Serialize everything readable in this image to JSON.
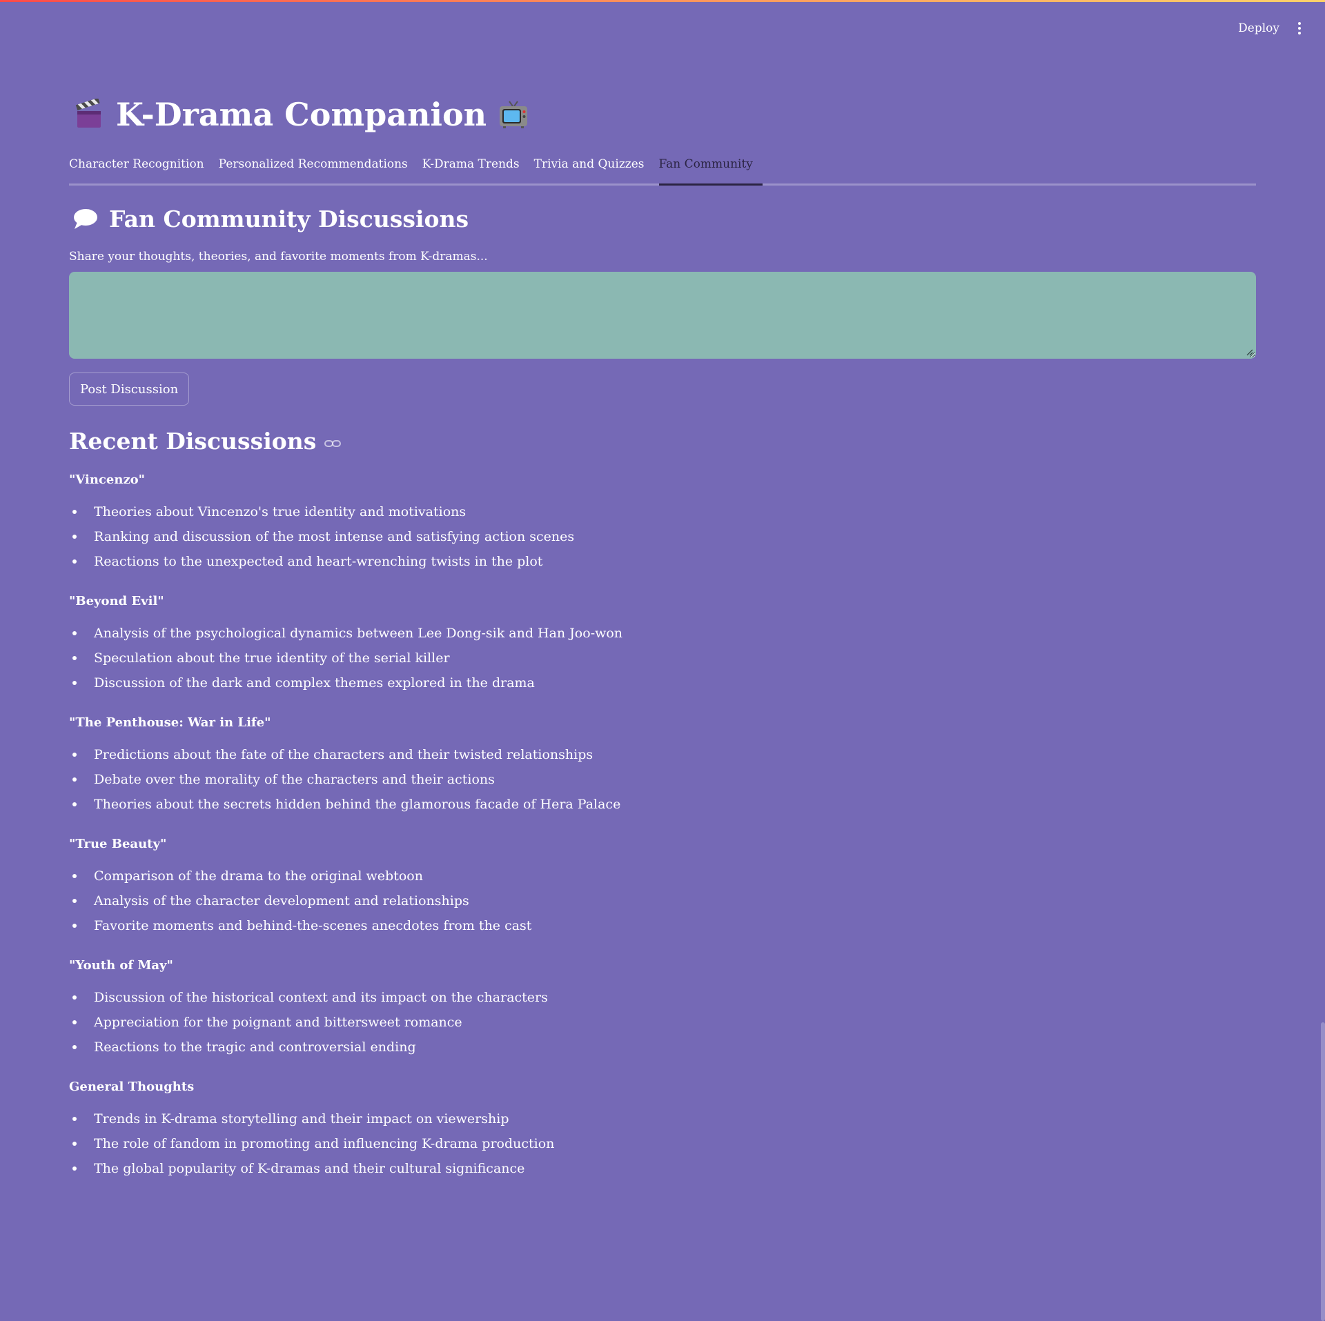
{
  "header": {
    "deploy_label": "Deploy",
    "menu_icon": "more-vertical-icon"
  },
  "app": {
    "title": "K-Drama Companion",
    "title_icon_left": "clapper-board-icon",
    "title_icon_right": "television-icon"
  },
  "tabs": [
    {
      "label": "Character Recognition",
      "active": false
    },
    {
      "label": "Personalized Recommendations",
      "active": false
    },
    {
      "label": "K-Drama Trends",
      "active": false
    },
    {
      "label": "Trivia and Quizzes",
      "active": false
    },
    {
      "label": "Fan Community",
      "active": true
    }
  ],
  "fan_community": {
    "heading": "Fan Community Discussions",
    "heading_icon": "speech-balloon-icon",
    "input_label": "Share your thoughts, theories, and favorite moments from K-dramas...",
    "input_value": "",
    "post_button_label": "Post Discussion"
  },
  "recent": {
    "heading": "Recent Discussions",
    "heading_icon": "link-icon",
    "topics": [
      {
        "title": "\"Vincenzo\"",
        "items": [
          "Theories about Vincenzo's true identity and motivations",
          "Ranking and discussion of the most intense and satisfying action scenes",
          "Reactions to the unexpected and heart-wrenching twists in the plot"
        ]
      },
      {
        "title": "\"Beyond Evil\"",
        "items": [
          "Analysis of the psychological dynamics between Lee Dong-sik and Han Joo-won",
          "Speculation about the true identity of the serial killer",
          "Discussion of the dark and complex themes explored in the drama"
        ]
      },
      {
        "title": "\"The Penthouse: War in Life\"",
        "items": [
          "Predictions about the fate of the characters and their twisted relationships",
          "Debate over the morality of the characters and their actions",
          "Theories about the secrets hidden behind the glamorous facade of Hera Palace"
        ]
      },
      {
        "title": "\"True Beauty\"",
        "items": [
          "Comparison of the drama to the original webtoon",
          "Analysis of the character development and relationships",
          "Favorite moments and behind-the-scenes anecdotes from the cast"
        ]
      },
      {
        "title": "\"Youth of May\"",
        "items": [
          "Discussion of the historical context and its impact on the characters",
          "Appreciation for the poignant and bittersweet romance",
          "Reactions to the tragic and controversial ending"
        ]
      },
      {
        "title": "General Thoughts",
        "items": [
          "Trends in K-drama storytelling and their impact on viewership",
          "The role of fandom in promoting and influencing K-drama production",
          "The global popularity of K-dramas and their cultural significance"
        ]
      }
    ]
  },
  "colors": {
    "background": "#7569b6",
    "input_background": "#8bb8b2",
    "active_tab": "#2b2443",
    "text": "#ffffff"
  }
}
